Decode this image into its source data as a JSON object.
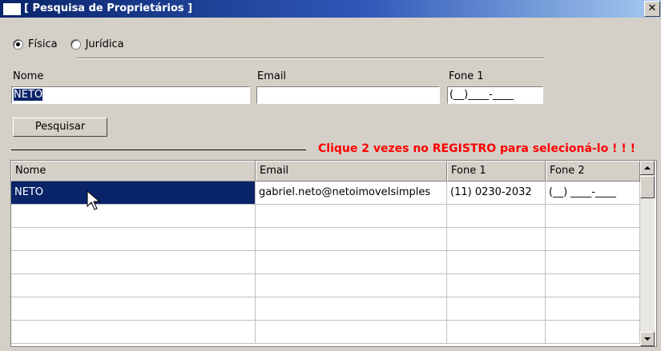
{
  "window": {
    "title": "[ Pesquisa de Proprietários ]",
    "close_glyph": "✕"
  },
  "person_type": {
    "options": [
      {
        "label": "Física",
        "checked": true
      },
      {
        "label": "Jurídica",
        "checked": false
      }
    ]
  },
  "filters": {
    "nome_label": "Nome",
    "nome_value": "NETO",
    "email_label": "Email",
    "email_value": "",
    "fone1_label": "Fone 1",
    "fone1_value": "(__)____-____"
  },
  "search_button": "Pesquisar",
  "hint": "Clique 2 vezes no REGISTRO para selecioná-lo ! ! !",
  "grid": {
    "columns": [
      "Nome",
      "Email",
      "Fone 1",
      "Fone 2"
    ],
    "rows": [
      [
        "NETO",
        "gabriel.neto@netoimoveIsimples",
        "(11) 0230-2032",
        "(__) ____-____"
      ]
    ],
    "selected_row": 0
  },
  "colors": {
    "selection": "#0a246a",
    "hint": "#ff0000",
    "face": "#d4d0c8"
  },
  "icons": [
    "window-icon",
    "close-icon",
    "scroll-up-icon",
    "scroll-down-icon",
    "mouse-pointer-icon"
  ]
}
